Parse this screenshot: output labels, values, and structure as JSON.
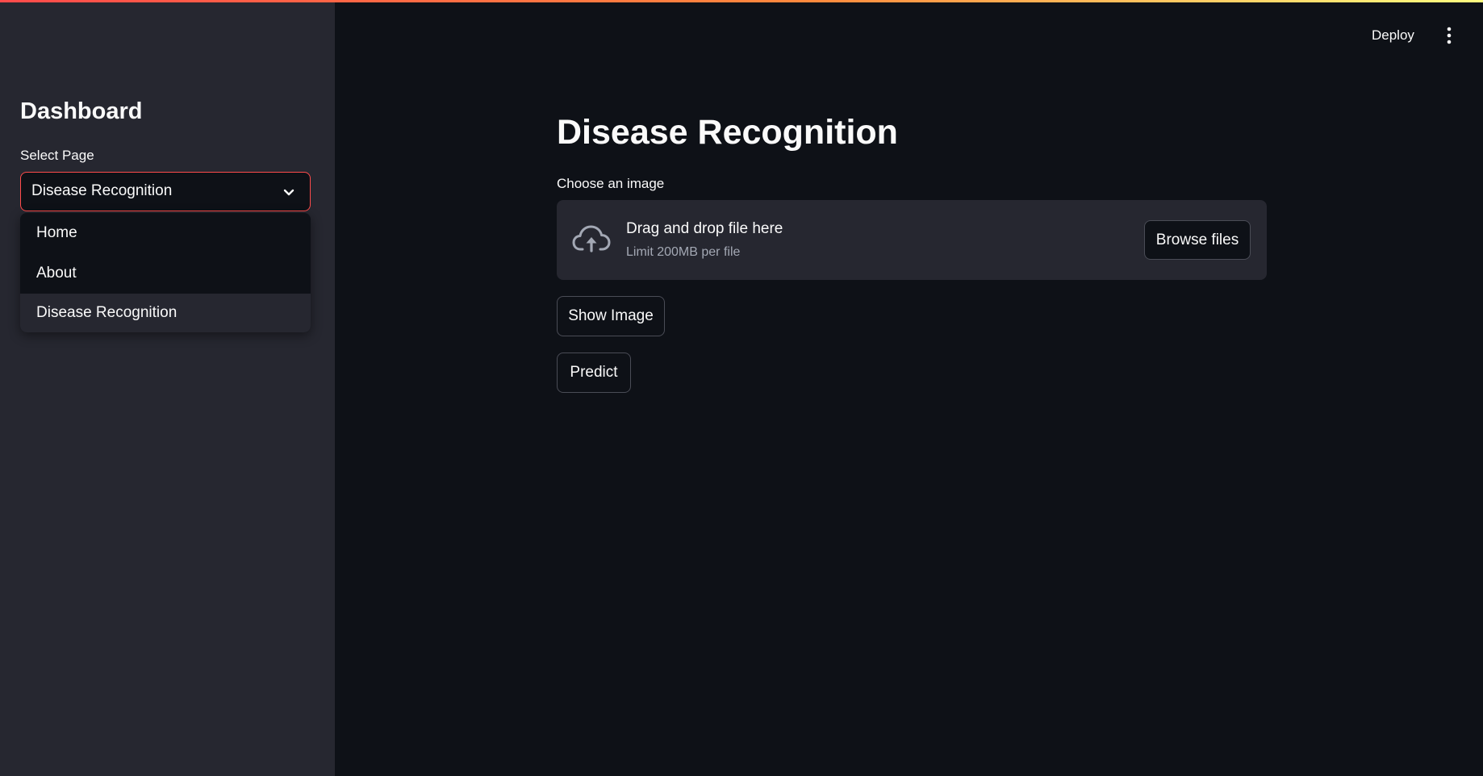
{
  "colors": {
    "accent": "#ff4b4b",
    "background": "#0e1117",
    "sidebar_background": "#262730",
    "text": "#fafafa",
    "muted_text": "#a3a8b4"
  },
  "header": {
    "deploy_label": "Deploy",
    "menu_icon": "vertical-ellipsis-icon"
  },
  "sidebar": {
    "title": "Dashboard",
    "select": {
      "label": "Select Page",
      "value": "Disease Recognition",
      "chevron_icon": "chevron-down-icon",
      "options": [
        "Home",
        "About",
        "Disease Recognition"
      ]
    }
  },
  "main": {
    "title": "Disease Recognition",
    "uploader": {
      "label": "Choose an image",
      "icon": "cloud-upload-icon",
      "drop_text": "Drag and drop file here",
      "limit_text": "Limit 200MB per file",
      "browse_label": "Browse files"
    },
    "show_image_label": "Show Image",
    "predict_label": "Predict"
  }
}
